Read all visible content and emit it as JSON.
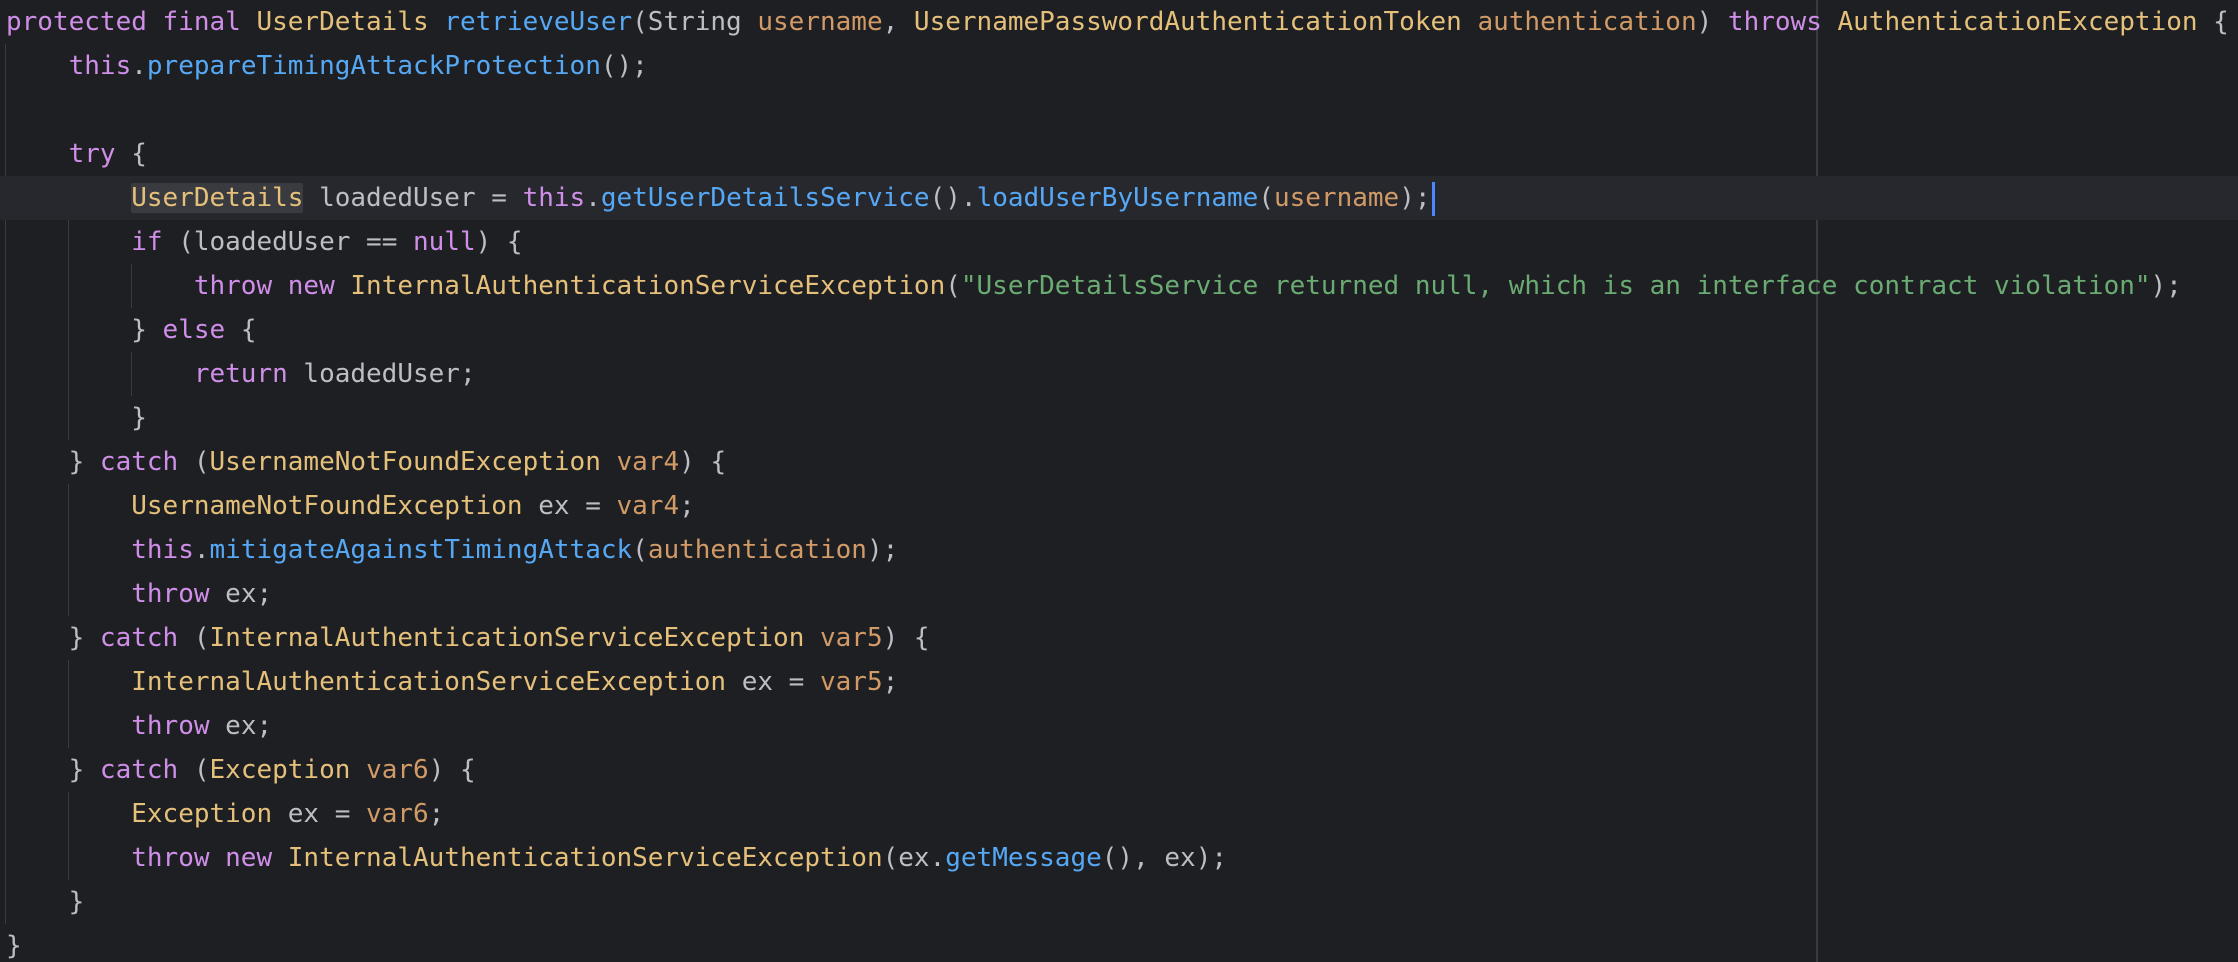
{
  "editor": {
    "language": "java",
    "theme_colors": {
      "background": "#1e1f22",
      "default_text": "#bcbec4",
      "keyword": "#cf8ee8",
      "type": "#e5c07b",
      "method": "#56a8f5",
      "parameter": "#d19a66",
      "string": "#6aab73",
      "caret": "#4a88ff"
    },
    "caret_line": 4,
    "lines": [
      [
        {
          "t": "protected final ",
          "c": "kw"
        },
        {
          "t": "UserDetails ",
          "c": "ty"
        },
        {
          "t": "retrieveUser",
          "c": "fn"
        },
        {
          "t": "(String ",
          "c": "pl"
        },
        {
          "t": "username",
          "c": "pa"
        },
        {
          "t": ", ",
          "c": "pl"
        },
        {
          "t": "UsernamePasswordAuthenticationToken ",
          "c": "ty"
        },
        {
          "t": "authentication",
          "c": "pa"
        },
        {
          "t": ") ",
          "c": "pl"
        },
        {
          "t": "throws ",
          "c": "kw"
        },
        {
          "t": "AuthenticationException",
          "c": "ty"
        },
        {
          "t": " {",
          "c": "pl"
        }
      ],
      [
        {
          "t": "    ",
          "c": "pl"
        },
        {
          "t": "this",
          "c": "kw"
        },
        {
          "t": ".",
          "c": "pl"
        },
        {
          "t": "prepareTimingAttackProtection",
          "c": "fn"
        },
        {
          "t": "();",
          "c": "pl"
        }
      ],
      [],
      [
        {
          "t": "    ",
          "c": "pl"
        },
        {
          "t": "try",
          "c": "kw"
        },
        {
          "t": " {",
          "c": "pl"
        }
      ],
      [
        {
          "t": "        ",
          "c": "pl"
        },
        {
          "t": "UserDetails",
          "c": "ty",
          "sel": true
        },
        {
          "t": " loadedUser = ",
          "c": "pl"
        },
        {
          "t": "this",
          "c": "kw"
        },
        {
          "t": ".",
          "c": "pl"
        },
        {
          "t": "getUserDetailsService",
          "c": "fn"
        },
        {
          "t": "().",
          "c": "pl"
        },
        {
          "t": "loadUserByUsername",
          "c": "fn"
        },
        {
          "t": "(",
          "c": "pl"
        },
        {
          "t": "username",
          "c": "pa"
        },
        {
          "t": ");",
          "c": "pl"
        }
      ],
      [
        {
          "t": "        ",
          "c": "pl"
        },
        {
          "t": "if",
          "c": "kw"
        },
        {
          "t": " (loadedUser == ",
          "c": "pl"
        },
        {
          "t": "null",
          "c": "kw"
        },
        {
          "t": ") {",
          "c": "pl"
        }
      ],
      [
        {
          "t": "            ",
          "c": "pl"
        },
        {
          "t": "throw new ",
          "c": "kw"
        },
        {
          "t": "InternalAuthenticationServiceException",
          "c": "ty"
        },
        {
          "t": "(",
          "c": "pl"
        },
        {
          "t": "\"UserDetailsService returned null, which is an interface contract violation\"",
          "c": "st"
        },
        {
          "t": ");",
          "c": "pl"
        }
      ],
      [
        {
          "t": "        } ",
          "c": "pl"
        },
        {
          "t": "else",
          "c": "kw"
        },
        {
          "t": " {",
          "c": "pl"
        }
      ],
      [
        {
          "t": "            ",
          "c": "pl"
        },
        {
          "t": "return",
          "c": "kw"
        },
        {
          "t": " loadedUser;",
          "c": "pl"
        }
      ],
      [
        {
          "t": "        }",
          "c": "pl"
        }
      ],
      [
        {
          "t": "    } ",
          "c": "pl"
        },
        {
          "t": "catch",
          "c": "kw"
        },
        {
          "t": " (",
          "c": "pl"
        },
        {
          "t": "UsernameNotFoundException ",
          "c": "ty"
        },
        {
          "t": "var4",
          "c": "pa"
        },
        {
          "t": ") {",
          "c": "pl"
        }
      ],
      [
        {
          "t": "        ",
          "c": "pl"
        },
        {
          "t": "UsernameNotFoundException",
          "c": "ty"
        },
        {
          "t": " ex = ",
          "c": "pl"
        },
        {
          "t": "var4",
          "c": "pa"
        },
        {
          "t": ";",
          "c": "pl"
        }
      ],
      [
        {
          "t": "        ",
          "c": "pl"
        },
        {
          "t": "this",
          "c": "kw"
        },
        {
          "t": ".",
          "c": "pl"
        },
        {
          "t": "mitigateAgainstTimingAttack",
          "c": "fn"
        },
        {
          "t": "(",
          "c": "pl"
        },
        {
          "t": "authentication",
          "c": "pa"
        },
        {
          "t": ");",
          "c": "pl"
        }
      ],
      [
        {
          "t": "        ",
          "c": "pl"
        },
        {
          "t": "throw",
          "c": "kw"
        },
        {
          "t": " ex;",
          "c": "pl"
        }
      ],
      [
        {
          "t": "    } ",
          "c": "pl"
        },
        {
          "t": "catch",
          "c": "kw"
        },
        {
          "t": " (",
          "c": "pl"
        },
        {
          "t": "InternalAuthenticationServiceException ",
          "c": "ty"
        },
        {
          "t": "var5",
          "c": "pa"
        },
        {
          "t": ") {",
          "c": "pl"
        }
      ],
      [
        {
          "t": "        ",
          "c": "pl"
        },
        {
          "t": "InternalAuthenticationServiceException",
          "c": "ty"
        },
        {
          "t": " ex = ",
          "c": "pl"
        },
        {
          "t": "var5",
          "c": "pa"
        },
        {
          "t": ";",
          "c": "pl"
        }
      ],
      [
        {
          "t": "        ",
          "c": "pl"
        },
        {
          "t": "throw",
          "c": "kw"
        },
        {
          "t": " ex;",
          "c": "pl"
        }
      ],
      [
        {
          "t": "    } ",
          "c": "pl"
        },
        {
          "t": "catch",
          "c": "kw"
        },
        {
          "t": " (",
          "c": "pl"
        },
        {
          "t": "Exception ",
          "c": "ty"
        },
        {
          "t": "var6",
          "c": "pa"
        },
        {
          "t": ") {",
          "c": "pl"
        }
      ],
      [
        {
          "t": "        ",
          "c": "pl"
        },
        {
          "t": "Exception",
          "c": "ty"
        },
        {
          "t": " ex = ",
          "c": "pl"
        },
        {
          "t": "var6",
          "c": "pa"
        },
        {
          "t": ";",
          "c": "pl"
        }
      ],
      [
        {
          "t": "        ",
          "c": "pl"
        },
        {
          "t": "throw new ",
          "c": "kw"
        },
        {
          "t": "InternalAuthenticationServiceException",
          "c": "ty"
        },
        {
          "t": "(ex.",
          "c": "pl"
        },
        {
          "t": "getMessage",
          "c": "fn"
        },
        {
          "t": "(), ex);",
          "c": "pl"
        }
      ],
      [
        {
          "t": "    }",
          "c": "pl"
        }
      ],
      [
        {
          "t": "}",
          "c": "pl"
        }
      ]
    ]
  }
}
